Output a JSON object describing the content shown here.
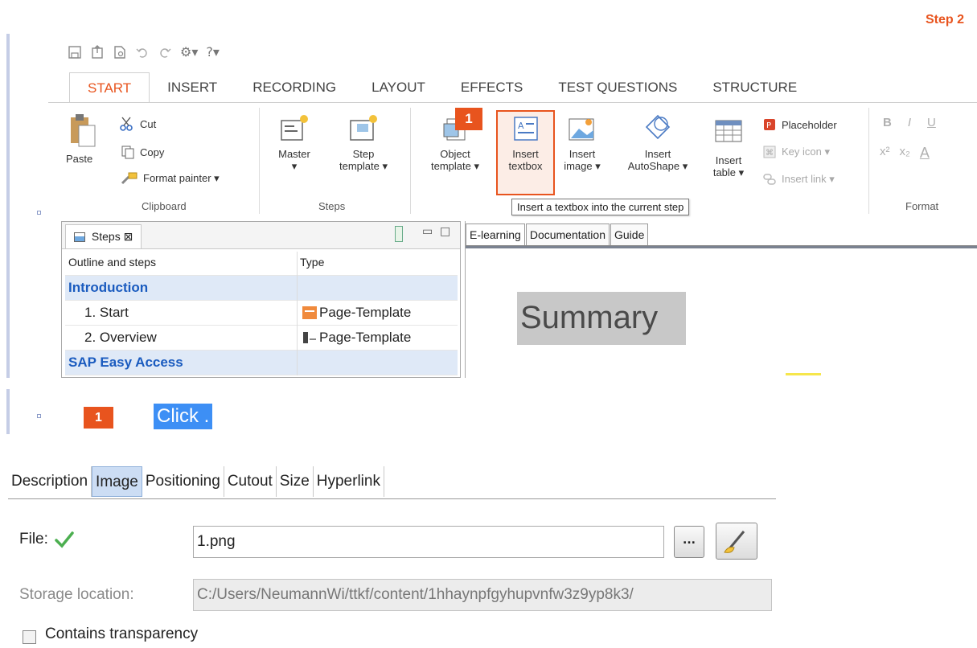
{
  "step_label": "Step 2",
  "quick_access": {
    "settings_label": "⚙▾",
    "help_label": "?▾"
  },
  "ribbon": {
    "tabs": [
      "START",
      "INSERT",
      "RECORDING",
      "LAYOUT",
      "EFFECTS",
      "TEST QUESTIONS",
      "STRUCTURE"
    ],
    "active_tab": "START",
    "clipboard": {
      "paste": "Paste",
      "cut": "Cut",
      "copy": "Copy",
      "format_painter": "Format painter ▾",
      "group_label": "Clipboard"
    },
    "steps": {
      "master_line1": "Master",
      "master_line2": "▾",
      "step_template_line1": "Step",
      "step_template_line2": "template ▾",
      "group_label": "Steps"
    },
    "insert": {
      "object_template_line1": "Object",
      "object_template_line2": "template ▾",
      "insert_textbox_line1": "Insert",
      "insert_textbox_line2": "textbox",
      "insert_image_line1": "Insert",
      "insert_image_line2": "image ▾",
      "insert_autoshape_line1": "Insert",
      "insert_autoshape_line2": "AutoShape ▾",
      "insert_table_line1": "Insert",
      "insert_table_line2": "table ▾",
      "placeholder": "Placeholder",
      "key_icon": "Key icon ▾",
      "insert_link": "Insert link ▾"
    },
    "format": {
      "group_label": "Format",
      "bold": "B",
      "italic": "I",
      "underline": "U",
      "superscript": "x²",
      "subscript": "x₂",
      "font_color": "A"
    },
    "marker_number": "1",
    "tooltip": "Insert a textbox into the current step"
  },
  "steps_panel": {
    "tab_label": "Steps ⊠",
    "columns": [
      "Outline and steps",
      "Type"
    ],
    "rows": [
      {
        "name": "Introduction",
        "type": "",
        "group": true
      },
      {
        "name": "1. Start",
        "type": "Page-Template",
        "group": false
      },
      {
        "name": "2. Overview",
        "type": "Page-Template",
        "group": false
      },
      {
        "name": "SAP Easy Access",
        "type": "",
        "group": true
      }
    ]
  },
  "preview": {
    "tabs": [
      "E-learning",
      "Documentation",
      "Guide"
    ],
    "summary_text": "Summary"
  },
  "instruction": {
    "marker": "1",
    "text": "Click ."
  },
  "properties": {
    "tabs": [
      "Description",
      "Image",
      "Positioning",
      "Cutout",
      "Size",
      "Hyperlink"
    ],
    "active_tab": "Image",
    "file_label": "File:",
    "file_value": "1.png",
    "browse_label": "...",
    "storage_label": "Storage location:",
    "storage_value": "C:/Users/NeumannWi/ttkf/content/1hhaynpfgyhupvnfw3z9yp8k3/",
    "transparency_label": "Contains transparency"
  },
  "colors": {
    "accent": "#e8541e",
    "selection": "#3d8ff5",
    "group_text": "#1a5bbf",
    "active_tab_bg": "#ccddf4"
  }
}
